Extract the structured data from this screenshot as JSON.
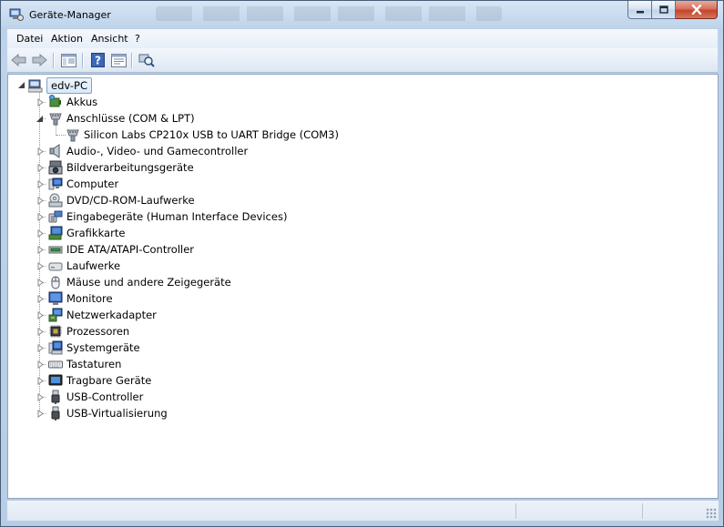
{
  "window": {
    "title": "Geräte-Manager",
    "buttons": {
      "minimize": "minimize-icon",
      "maximize": "maximize-icon",
      "close": "close-icon"
    }
  },
  "menu": {
    "items": [
      "Datei",
      "Aktion",
      "Ansicht",
      "?"
    ]
  },
  "toolbar": {
    "buttons": [
      "back-arrow-icon",
      "forward-arrow-icon",
      "show-hide-console-tree-icon",
      "help-icon",
      "properties-icon",
      "scan-hardware-icon"
    ]
  },
  "tree": {
    "root": "edv-PC",
    "nodes": [
      {
        "label": "Akkus",
        "icon": "battery-icon",
        "expanded": false,
        "children": []
      },
      {
        "label": "Anschlüsse (COM & LPT)",
        "icon": "port-icon",
        "expanded": true,
        "children": [
          {
            "label": "Silicon Labs CP210x USB to UART Bridge (COM3)",
            "icon": "port-icon"
          }
        ]
      },
      {
        "label": "Audio-, Video- und Gamecontroller",
        "icon": "speaker-icon",
        "expanded": false,
        "children": []
      },
      {
        "label": "Bildverarbeitungsgeräte",
        "icon": "camera-icon",
        "expanded": false,
        "children": []
      },
      {
        "label": "Computer",
        "icon": "computer-icon",
        "expanded": false,
        "children": []
      },
      {
        "label": "DVD/CD-ROM-Laufwerke",
        "icon": "dvd-drive-icon",
        "expanded": false,
        "children": []
      },
      {
        "label": "Eingabegeräte (Human Interface Devices)",
        "icon": "hid-icon",
        "expanded": false,
        "children": []
      },
      {
        "label": "Grafikkarte",
        "icon": "display-adapter-icon",
        "expanded": false,
        "children": []
      },
      {
        "label": "IDE ATA/ATAPI-Controller",
        "icon": "ide-controller-icon",
        "expanded": false,
        "children": []
      },
      {
        "label": "Laufwerke",
        "icon": "disk-drive-icon",
        "expanded": false,
        "children": []
      },
      {
        "label": "Mäuse und andere Zeigegeräte",
        "icon": "mouse-icon",
        "expanded": false,
        "children": []
      },
      {
        "label": "Monitore",
        "icon": "monitor-icon",
        "expanded": false,
        "children": []
      },
      {
        "label": "Netzwerkadapter",
        "icon": "network-adapter-icon",
        "expanded": false,
        "children": []
      },
      {
        "label": "Prozessoren",
        "icon": "processor-icon",
        "expanded": false,
        "children": []
      },
      {
        "label": "Systemgeräte",
        "icon": "system-device-icon",
        "expanded": false,
        "children": []
      },
      {
        "label": "Tastaturen",
        "icon": "keyboard-icon",
        "expanded": false,
        "children": []
      },
      {
        "label": "Tragbare Geräte",
        "icon": "portable-device-icon",
        "expanded": false,
        "children": []
      },
      {
        "label": "USB-Controller",
        "icon": "usb-icon",
        "expanded": false,
        "children": []
      },
      {
        "label": "USB-Virtualisierung",
        "icon": "usb-icon",
        "expanded": false,
        "children": []
      }
    ]
  },
  "colors": {
    "frame": "#bfd3ea",
    "selection_border": "#7da2ce",
    "close_button": "#c4452c"
  }
}
